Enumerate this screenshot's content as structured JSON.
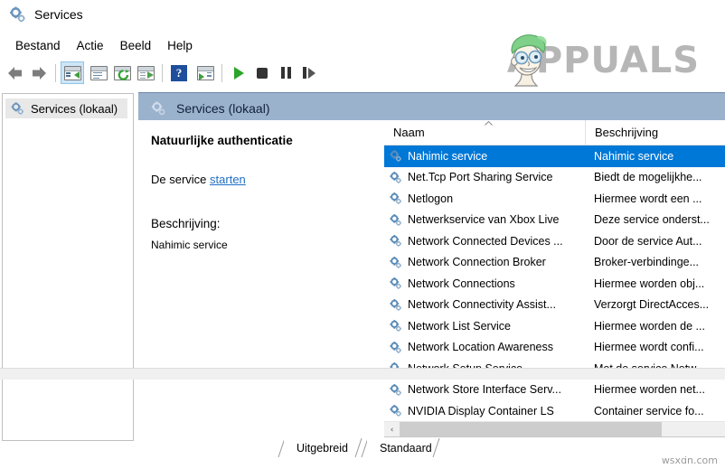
{
  "window": {
    "title": "Services",
    "icon": "services-gear-icon"
  },
  "menu": {
    "items": [
      {
        "label": "Bestand",
        "name": "menu-bestand"
      },
      {
        "label": "Actie",
        "name": "menu-actie"
      },
      {
        "label": "Beeld",
        "name": "menu-beeld"
      },
      {
        "label": "Help",
        "name": "menu-help"
      }
    ]
  },
  "toolbar": {
    "buttons": [
      {
        "name": "back-arrow-icon",
        "type": "back"
      },
      {
        "name": "forward-arrow-icon",
        "type": "forward"
      },
      {
        "name": "show-hide-console-tree-icon",
        "type": "tree",
        "active": true
      },
      {
        "name": "properties-icon",
        "type": "properties"
      },
      {
        "name": "refresh-icon",
        "type": "refresh"
      },
      {
        "name": "export-list-icon",
        "type": "export"
      },
      {
        "name": "help-icon",
        "type": "help",
        "glyph": "?"
      },
      {
        "name": "show-action-pane-icon",
        "type": "actionpane"
      },
      {
        "name": "start-service-icon",
        "type": "play"
      },
      {
        "name": "stop-service-icon",
        "type": "stop"
      },
      {
        "name": "pause-service-icon",
        "type": "pause"
      },
      {
        "name": "restart-service-icon",
        "type": "resume"
      }
    ]
  },
  "watermark": {
    "brand": "APPUALS",
    "brand_tail": "PPUALS",
    "brand_lead": "A",
    "corner": "wsxdn.com"
  },
  "tree": {
    "items": [
      {
        "label": "Services (lokaal)",
        "name": "tree-item-services-lokaal",
        "selected": true
      }
    ]
  },
  "pane": {
    "header": "Services (lokaal)"
  },
  "detail": {
    "title": "Natuurlijke authenticatie",
    "action_prefix": "De service ",
    "action_link": "starten",
    "description_label": "Beschrijving:",
    "description_text": "Nahimic service"
  },
  "list": {
    "columns": [
      {
        "label": "Naam",
        "name": "column-header-naam",
        "sort": "asc"
      },
      {
        "label": "Beschrijving",
        "name": "column-header-beschrijving",
        "sort": ""
      }
    ],
    "rows": [
      {
        "name": "Nahimic service",
        "description": "Nahimic service",
        "selected": true
      },
      {
        "name": "Net.Tcp Port Sharing Service",
        "description": "Biedt de mogelijkhe...",
        "selected": false
      },
      {
        "name": "Netlogon",
        "description": "Hiermee wordt een ...",
        "selected": false
      },
      {
        "name": "Netwerkservice van Xbox Live",
        "description": "Deze service onderst...",
        "selected": false
      },
      {
        "name": "Network Connected Devices ...",
        "description": "Door de service Aut...",
        "selected": false
      },
      {
        "name": "Network Connection Broker",
        "description": "Broker-verbindinge...",
        "selected": false
      },
      {
        "name": "Network Connections",
        "description": "Hiermee worden obj...",
        "selected": false
      },
      {
        "name": "Network Connectivity Assist...",
        "description": "Verzorgt DirectAcces...",
        "selected": false
      },
      {
        "name": "Network List Service",
        "description": "Hiermee worden de ...",
        "selected": false
      },
      {
        "name": "Network Location Awareness",
        "description": "Hiermee wordt confi...",
        "selected": false
      },
      {
        "name": "Network Setup Service",
        "description": "Met de service Netw...",
        "selected": false
      },
      {
        "name": "Network Store Interface Serv...",
        "description": "Hiermee worden net...",
        "selected": false
      },
      {
        "name": "NVIDIA Display Container LS",
        "description": "Container service fo...",
        "selected": false
      }
    ],
    "scroll_left_arrow": "‹"
  },
  "tabs": [
    {
      "label": "Uitgebreid",
      "name": "tab-uitgebreid",
      "active": true
    },
    {
      "label": "Standaard",
      "name": "tab-standaard",
      "active": false
    }
  ],
  "colors": {
    "selection_blue": "#0078d7",
    "header_band": "#9bb2cd",
    "link_blue": "#1f6fc4",
    "gear_blue": "#5b8cb8"
  }
}
